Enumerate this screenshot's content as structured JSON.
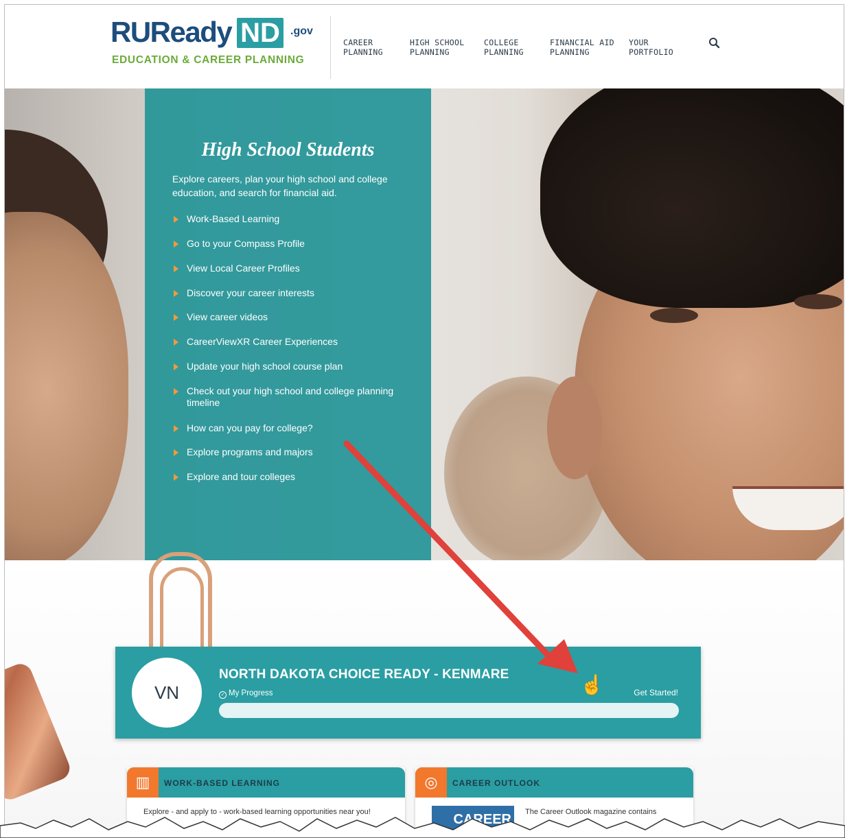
{
  "logo": {
    "main": "RUReady",
    "nd": "ND",
    "gov": ".gov",
    "tagline": "EDUCATION & CAREER PLANNING"
  },
  "nav": {
    "items": [
      {
        "label": "CAREER\nPLANNING"
      },
      {
        "label": "HIGH SCHOOL\nPLANNING"
      },
      {
        "label": "COLLEGE\nPLANNING"
      },
      {
        "label": "FINANCIAL AID\nPLANNING"
      },
      {
        "label": "YOUR\nPORTFOLIO"
      }
    ],
    "search_icon": "search-icon"
  },
  "hero": {
    "title": "High School Students",
    "intro": "Explore careers, plan your high school and college education, and search for financial aid.",
    "links": [
      "Work-Based Learning",
      "Go to your Compass Profile",
      "View Local Career Profiles",
      "Discover your career interests",
      "View career videos",
      "CareerViewXR Career Experiences",
      "Update your high school course plan",
      "Check out your high school and college planning timeline",
      "How can you pay for college?",
      "Explore programs and majors",
      "Explore and tour colleges"
    ],
    "bullet_color": "#f39a3a",
    "panel_color": "#269498"
  },
  "progress_card": {
    "initials": "VN",
    "title": "NORTH DAKOTA CHOICE READY - KENMARE",
    "progress_label": "My Progress",
    "get_started": "Get Started!",
    "progress_fraction": 0
  },
  "mini_cards": [
    {
      "title": "WORK-BASED LEARNING",
      "text": "Explore - and apply to - work-based learning opportunities near you!",
      "icon": "building-icon"
    },
    {
      "title": "CAREER OUTLOOK",
      "text": "The Career Outlook magazine contains",
      "icon": "lightbulb-target-icon",
      "magazine_label": "CAREER"
    }
  ],
  "annotation": {
    "arrow_color": "#e0413a"
  }
}
